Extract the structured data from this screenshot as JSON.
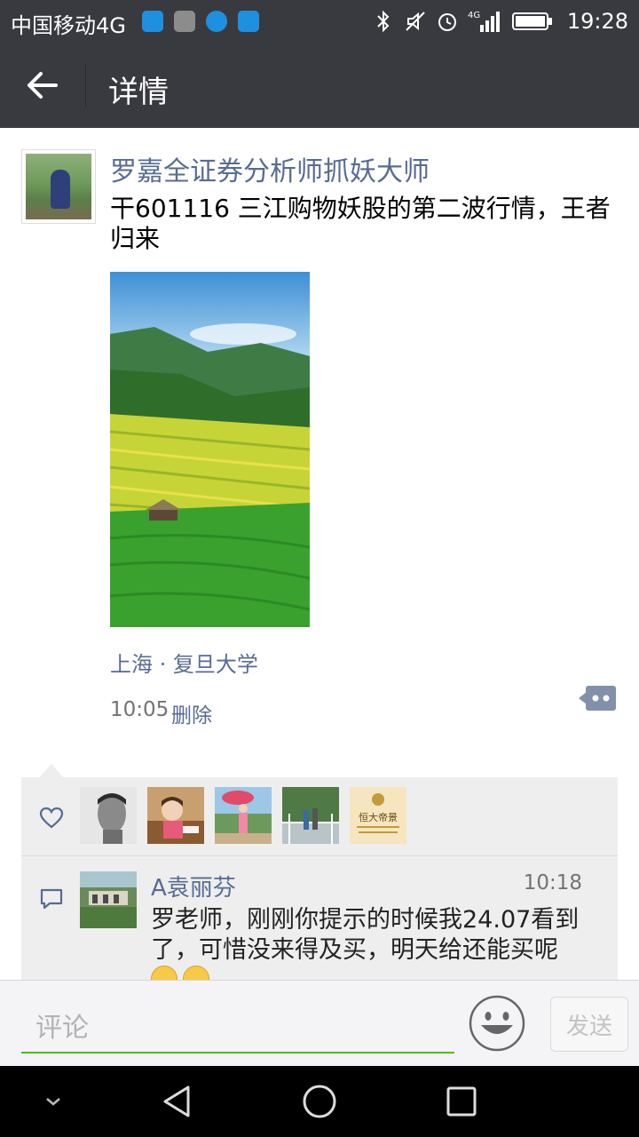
{
  "status_bar": {
    "carrier": "中国移动4G",
    "network": "4G",
    "time": "19:28"
  },
  "header": {
    "title": "详情"
  },
  "post": {
    "author": "罗嘉全证券分析师抓妖大师",
    "text": "干601116 三江购物妖股的第二波行情，王者归来",
    "location": "上海 · 复旦大学",
    "time": "10:05",
    "delete_label": "删除"
  },
  "comments": [
    {
      "name": "A袁丽芬",
      "time": "10:18",
      "text": "罗老师，刚刚你提示的时候我24.07看到了，可惜没来得及买，明天给还能买呢"
    }
  ],
  "comment_bar": {
    "placeholder": "评论",
    "send_label": "发送"
  },
  "like_avatar_5": {
    "line1": "恒大帝景"
  },
  "colors": {
    "link": "#576b95",
    "header_bg": "#393a3f",
    "accent_green": "#45c01a"
  }
}
